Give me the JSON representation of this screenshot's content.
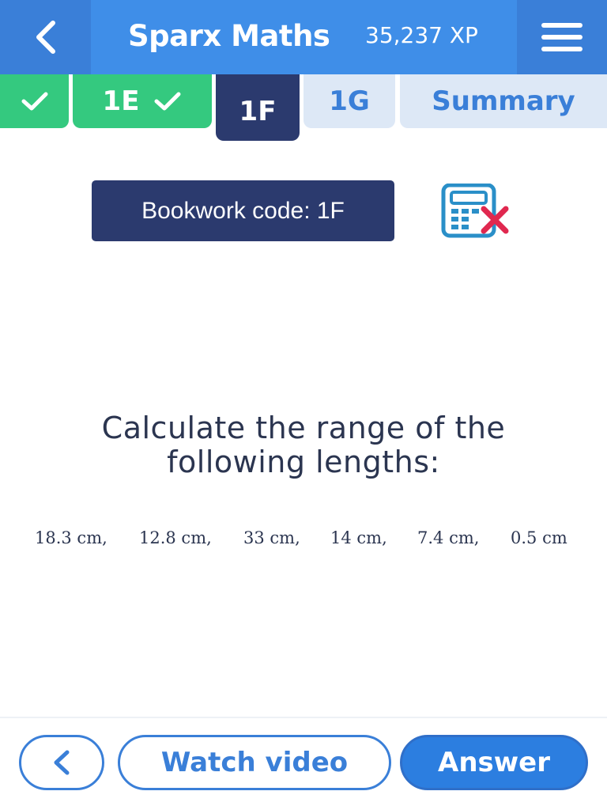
{
  "header": {
    "title": "Sparx Maths",
    "xp": "35,237 XP"
  },
  "tabs": [
    {
      "label": "",
      "state": "complete"
    },
    {
      "label": "1E",
      "state": "complete"
    },
    {
      "label": "1F",
      "state": "active"
    },
    {
      "label": "1G",
      "state": "todo"
    },
    {
      "label": "Summary",
      "state": "todo"
    }
  ],
  "bookwork": {
    "label": "Bookwork code: 1F"
  },
  "question": {
    "text": "Calculate the range of the following lengths:",
    "lengths": [
      "18.3 cm,",
      "12.8 cm,",
      "33 cm,",
      "14 cm,",
      "7.4 cm,",
      "0.5 cm"
    ]
  },
  "footer": {
    "watch_video": "Watch video",
    "answer": "Answer"
  },
  "colors": {
    "header": "#3f8ee8",
    "complete": "#34c97f",
    "active": "#2b3a6e",
    "todo_bg": "#dde8f6",
    "accent": "#3a7fd8",
    "calculator_not_allowed": "#e0284f"
  },
  "icons": {
    "back": "chevron-left-icon",
    "menu": "hamburger-menu-icon",
    "check": "check-icon",
    "calculator": "calculator-not-allowed-icon"
  }
}
